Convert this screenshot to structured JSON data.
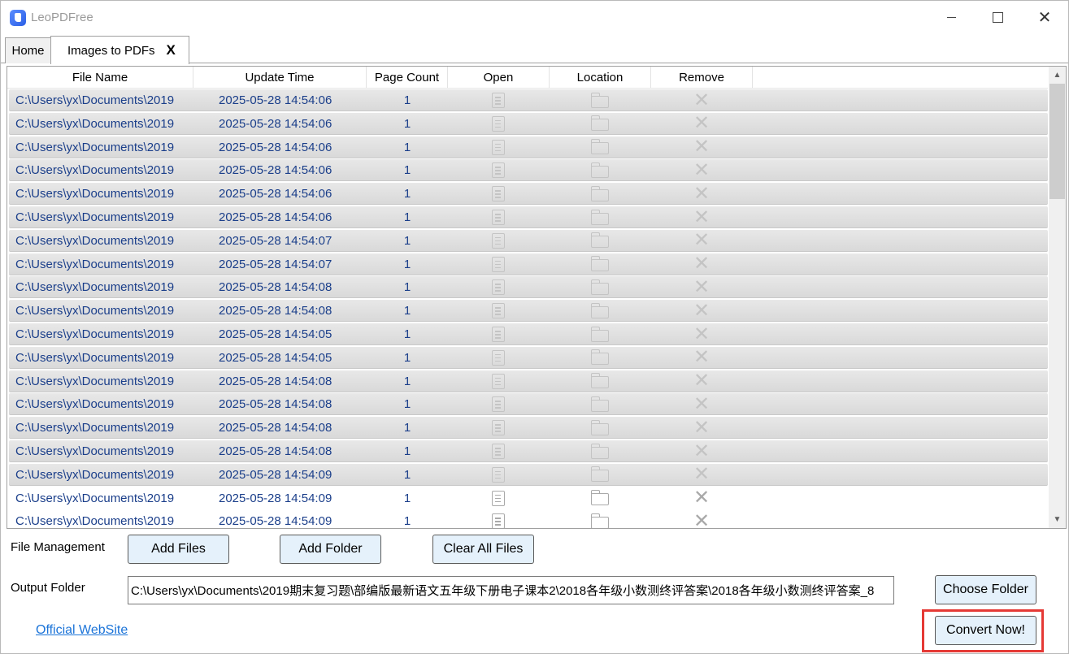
{
  "window": {
    "title": "LeoPDFree"
  },
  "tabs": [
    {
      "label": "Home"
    },
    {
      "label": "Images to PDFs",
      "close": "X"
    }
  ],
  "grid": {
    "columns": [
      "File Name",
      "Update Time",
      "Page Count",
      "Open",
      "Location",
      "Remove"
    ],
    "rows": [
      {
        "name": "C:\\Users\\yx\\Documents\\2019",
        "time": "2025-05-28 14:54:06",
        "count": "1"
      },
      {
        "name": "C:\\Users\\yx\\Documents\\2019",
        "time": "2025-05-28 14:54:06",
        "count": "1"
      },
      {
        "name": "C:\\Users\\yx\\Documents\\2019",
        "time": "2025-05-28 14:54:06",
        "count": "1"
      },
      {
        "name": "C:\\Users\\yx\\Documents\\2019",
        "time": "2025-05-28 14:54:06",
        "count": "1"
      },
      {
        "name": "C:\\Users\\yx\\Documents\\2019",
        "time": "2025-05-28 14:54:06",
        "count": "1"
      },
      {
        "name": "C:\\Users\\yx\\Documents\\2019",
        "time": "2025-05-28 14:54:06",
        "count": "1"
      },
      {
        "name": "C:\\Users\\yx\\Documents\\2019",
        "time": "2025-05-28 14:54:07",
        "count": "1"
      },
      {
        "name": "C:\\Users\\yx\\Documents\\2019",
        "time": "2025-05-28 14:54:07",
        "count": "1"
      },
      {
        "name": "C:\\Users\\yx\\Documents\\2019",
        "time": "2025-05-28 14:54:08",
        "count": "1"
      },
      {
        "name": "C:\\Users\\yx\\Documents\\2019",
        "time": "2025-05-28 14:54:08",
        "count": "1"
      },
      {
        "name": "C:\\Users\\yx\\Documents\\2019",
        "time": "2025-05-28 14:54:05",
        "count": "1"
      },
      {
        "name": "C:\\Users\\yx\\Documents\\2019",
        "time": "2025-05-28 14:54:05",
        "count": "1"
      },
      {
        "name": "C:\\Users\\yx\\Documents\\2019",
        "time": "2025-05-28 14:54:08",
        "count": "1"
      },
      {
        "name": "C:\\Users\\yx\\Documents\\2019",
        "time": "2025-05-28 14:54:08",
        "count": "1"
      },
      {
        "name": "C:\\Users\\yx\\Documents\\2019",
        "time": "2025-05-28 14:54:08",
        "count": "1"
      },
      {
        "name": "C:\\Users\\yx\\Documents\\2019",
        "time": "2025-05-28 14:54:08",
        "count": "1"
      },
      {
        "name": "C:\\Users\\yx\\Documents\\2019",
        "time": "2025-05-28 14:54:09",
        "count": "1"
      },
      {
        "name": "C:\\Users\\yx\\Documents\\2019",
        "time": "2025-05-28 14:54:09",
        "count": "1"
      },
      {
        "name": "C:\\Users\\yx\\Documents\\2019",
        "time": "2025-05-28 14:54:09",
        "count": "1"
      }
    ],
    "selected_count": 17
  },
  "file_management": {
    "label": "File Management",
    "add_files": "Add Files",
    "add_folder": "Add Folder",
    "clear_all": "Clear All Files"
  },
  "output": {
    "label": "Output Folder",
    "path": "C:\\Users\\yx\\Documents\\2019期末复习题\\部编版最新语文五年级下册电子课本2\\2018各年级小数测终评答案\\2018各年级小数测终评答案_8",
    "choose_folder": "Choose Folder"
  },
  "footer": {
    "website": "Official WebSite",
    "convert": "Convert Now!"
  },
  "colors": {
    "accent_text": "#1a3e8a",
    "button_bg": "#e5f1fb",
    "highlight": "#e53935",
    "link": "#1a73d8"
  }
}
